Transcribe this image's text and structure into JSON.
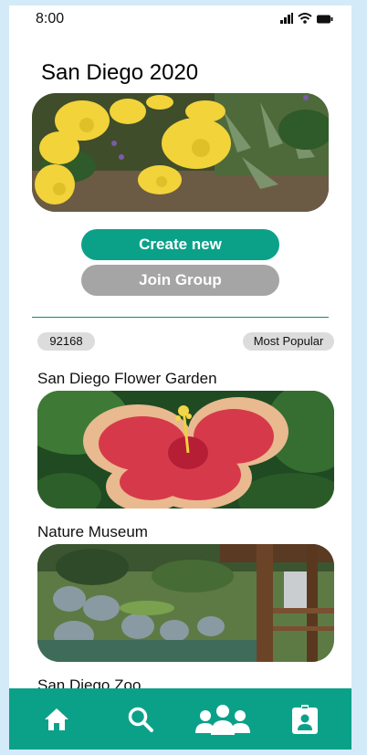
{
  "status": {
    "time": "8:00"
  },
  "page": {
    "title": "San Diego 2020"
  },
  "actions": {
    "create_label": "Create new",
    "join_label": "Join Group"
  },
  "filters": {
    "zip": "92168",
    "sort": "Most Popular"
  },
  "places": [
    {
      "name": "San Diego Flower Garden"
    },
    {
      "name": "Nature Museum"
    },
    {
      "name": "San Diego Zoo"
    }
  ],
  "nav": {
    "items": [
      {
        "icon": "home-icon"
      },
      {
        "icon": "search-icon"
      },
      {
        "icon": "group-icon"
      },
      {
        "icon": "profile-badge-icon"
      }
    ]
  },
  "colors": {
    "accent": "#0ba189",
    "secondary": "#a5a5a5",
    "frame": "#d3eaf8"
  }
}
